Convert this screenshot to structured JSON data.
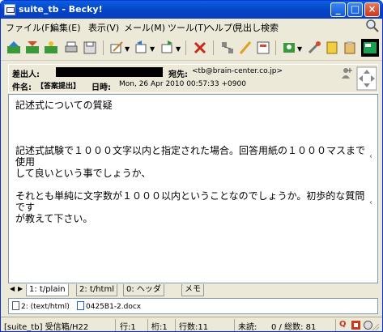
{
  "window": {
    "title": "suite_tb - Becky!"
  },
  "menu": {
    "items": [
      "ファイル(F)",
      "編集(E)",
      "表示(V)",
      "メール(M)",
      "ツール(T)",
      "ヘルプ(H)"
    ],
    "search_label": "見出し検索"
  },
  "header": {
    "from_label": "差出人:",
    "to_label": "宛先:",
    "to_value": "<tb@brain-center.co.jp>",
    "subject_label": "件名:",
    "subject_value": "【答案提出】",
    "date_label": "日時:",
    "date_value": "Mon, 26 Apr 2010 00:57:33 +0900"
  },
  "body": {
    "text": "記述式についての質疑\n\n\n\n記述式試験で１０００文字以内と指定された場合。回答用紙の１０００マスまで使用\nして良いという事でしょうか、\n\nそれとも単純に文字数が１０００以内ということなのでしょうか。初歩的な質問です\nが教えて下さい。"
  },
  "tabs": [
    {
      "label": "1: t/plain",
      "active": true
    },
    {
      "label": "2: t/html",
      "active": false
    },
    {
      "label": "0: ヘッダ",
      "active": false
    },
    {
      "label": "メモ",
      "active": false
    }
  ],
  "attachments": [
    {
      "label": "2: (text/html)"
    },
    {
      "label": "0425B1-2.docx"
    }
  ],
  "status": {
    "folder": "[suite_tb] 受信箱/H22",
    "line": "行:1",
    "col": "桁:1",
    "lines": "行数:11",
    "unread": "未読:",
    "counts": "0 / 総数: 81"
  },
  "colors": {
    "titlebar": "#0a5fe0",
    "window_bg": "#ece9d8",
    "accent_red": "#c8391d"
  }
}
